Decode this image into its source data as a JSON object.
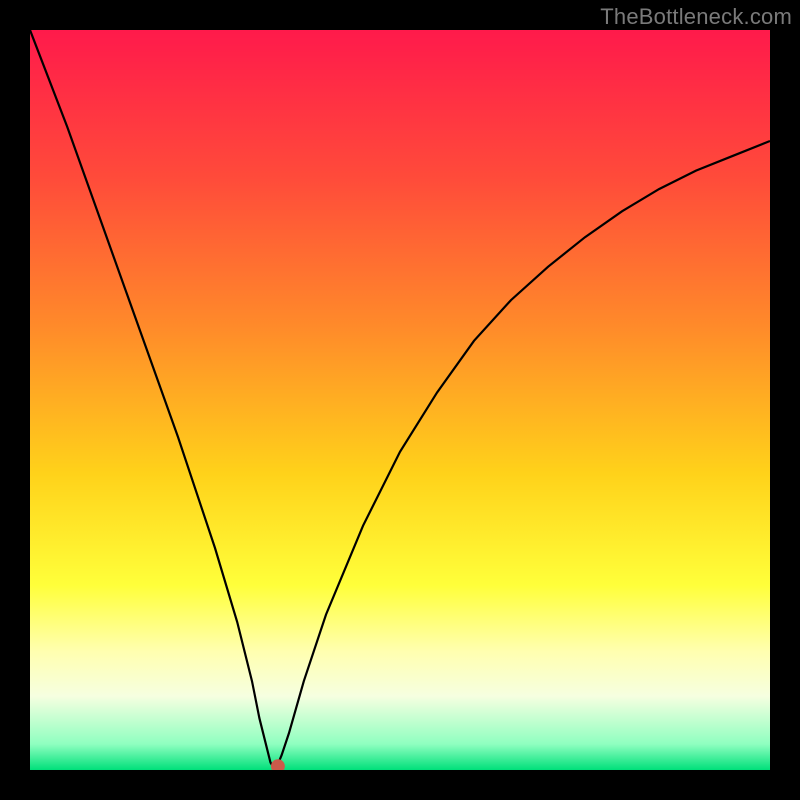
{
  "watermark": "TheBottleneck.com",
  "chart_data": {
    "type": "line",
    "title": "",
    "xlabel": "",
    "ylabel": "",
    "xlim": [
      0,
      100
    ],
    "ylim": [
      0,
      100
    ],
    "background_gradient": {
      "stops": [
        {
          "pos": 0.0,
          "color": "#ff1a4b"
        },
        {
          "pos": 0.2,
          "color": "#ff4b3a"
        },
        {
          "pos": 0.4,
          "color": "#ff8a2a"
        },
        {
          "pos": 0.6,
          "color": "#ffd21a"
        },
        {
          "pos": 0.75,
          "color": "#ffff3a"
        },
        {
          "pos": 0.84,
          "color": "#ffffb0"
        },
        {
          "pos": 0.9,
          "color": "#f6ffe0"
        },
        {
          "pos": 0.965,
          "color": "#8fffc0"
        },
        {
          "pos": 1.0,
          "color": "#00e07a"
        }
      ]
    },
    "curve": {
      "x": [
        0,
        5,
        10,
        15,
        20,
        25,
        28,
        30,
        31,
        32,
        32.5,
        33,
        33.5,
        34,
        35,
        37,
        40,
        45,
        50,
        55,
        60,
        65,
        70,
        75,
        80,
        85,
        90,
        95,
        100
      ],
      "y": [
        100,
        87,
        73,
        59,
        45,
        30,
        20,
        12,
        7,
        3,
        1,
        0.2,
        0.8,
        2,
        5,
        12,
        21,
        33,
        43,
        51,
        58,
        63.5,
        68,
        72,
        75.5,
        78.5,
        81,
        83,
        85
      ]
    },
    "marker": {
      "x": 33.5,
      "y": 0.5,
      "color": "#cc5a4a",
      "radius": 7
    }
  }
}
